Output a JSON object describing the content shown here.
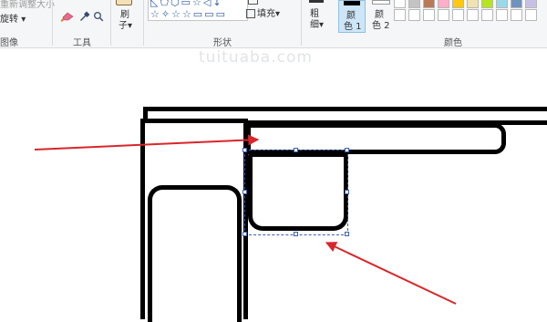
{
  "ribbon": {
    "image_group": {
      "resize_label": "重新调整大小",
      "rotate_label": "旋转",
      "group_label": "图像"
    },
    "tools_group": {
      "group_label": "工具",
      "tools": [
        {
          "name": "pencil-icon"
        },
        {
          "name": "eraser-icon"
        },
        {
          "name": "color-picker-icon"
        },
        {
          "name": "magnifier-icon"
        }
      ]
    },
    "brush": {
      "label_top": "刷",
      "label_bottom": "子"
    },
    "shapes_group": {
      "group_label": "形状",
      "row1": "◺⬠⬡▭☆◁↓",
      "row2": "☆✧☆☆▭▭▭",
      "fill_label": "填充"
    },
    "size": {
      "label_top": "粗",
      "label_bottom": "细"
    },
    "color1": {
      "label_top": "颜",
      "label_bottom": "色 1",
      "swatch": "#000000"
    },
    "color2": {
      "label_top": "颜",
      "label_bottom": "色 2",
      "swatch": "#ffffff"
    },
    "colors_group": {
      "group_label": "颜色",
      "row1": [
        "#ffffff",
        "#c3c3c3",
        "#b97a57",
        "#ffaec9",
        "#ffc90e",
        "#efe4b0",
        "#b5e61d",
        "#99d9ea",
        "#7092be",
        "#c8bfe7"
      ],
      "row2": [
        "#ffffff",
        "#ffffff",
        "#ffffff",
        "#ffffff",
        "#ffffff",
        "#ffffff",
        "#ffffff",
        "#ffffff",
        "#ffffff",
        "#ffffff"
      ]
    }
  },
  "canvas": {
    "watermark": "tuituaba.com",
    "annotation_color": "#d9262b"
  }
}
